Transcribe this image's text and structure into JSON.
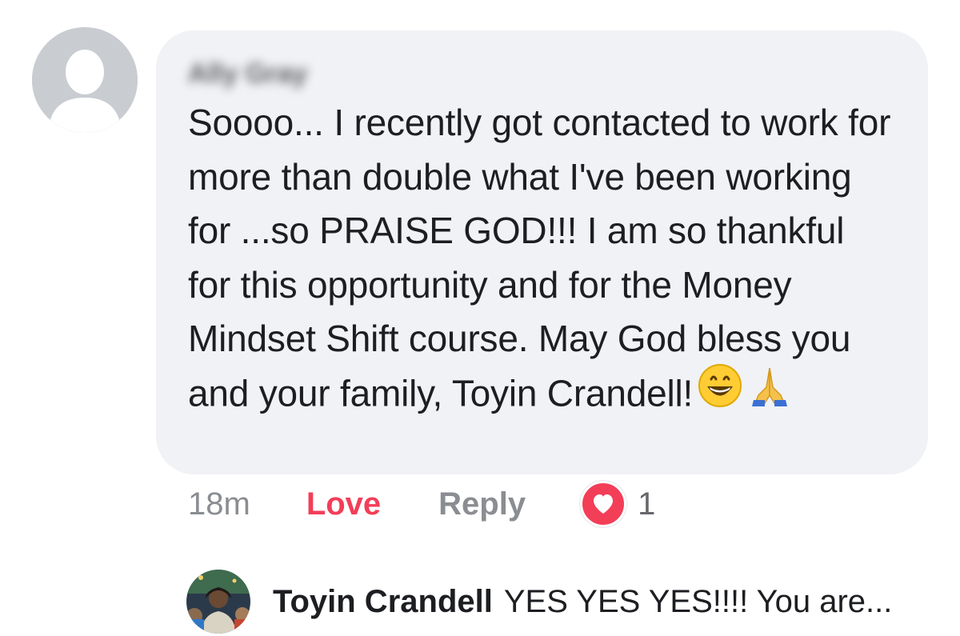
{
  "comment": {
    "author_blurred": "Ally Gray",
    "text": "Soooo... I recently got contacted to work for more than double what I've been working for ...so PRAISE GOD!!! I am so thankful for this opportunity and for the Money Mindset Shift course. May God bless you and your family, Toyin Crandell!",
    "emojis": [
      "grinning-face",
      "folded-hands"
    ],
    "timestamp": "18m",
    "love_label": "Love",
    "reply_label": "Reply",
    "reaction_icon": "heart-icon",
    "reaction_count": "1"
  },
  "reply_preview": {
    "author": "Toyin Crandell",
    "snippet": "YES YES YES!!!! You are..."
  },
  "colors": {
    "bubble_bg": "#f0f2f5",
    "love_red": "#f33e58",
    "muted_gray": "#8a8d91"
  }
}
